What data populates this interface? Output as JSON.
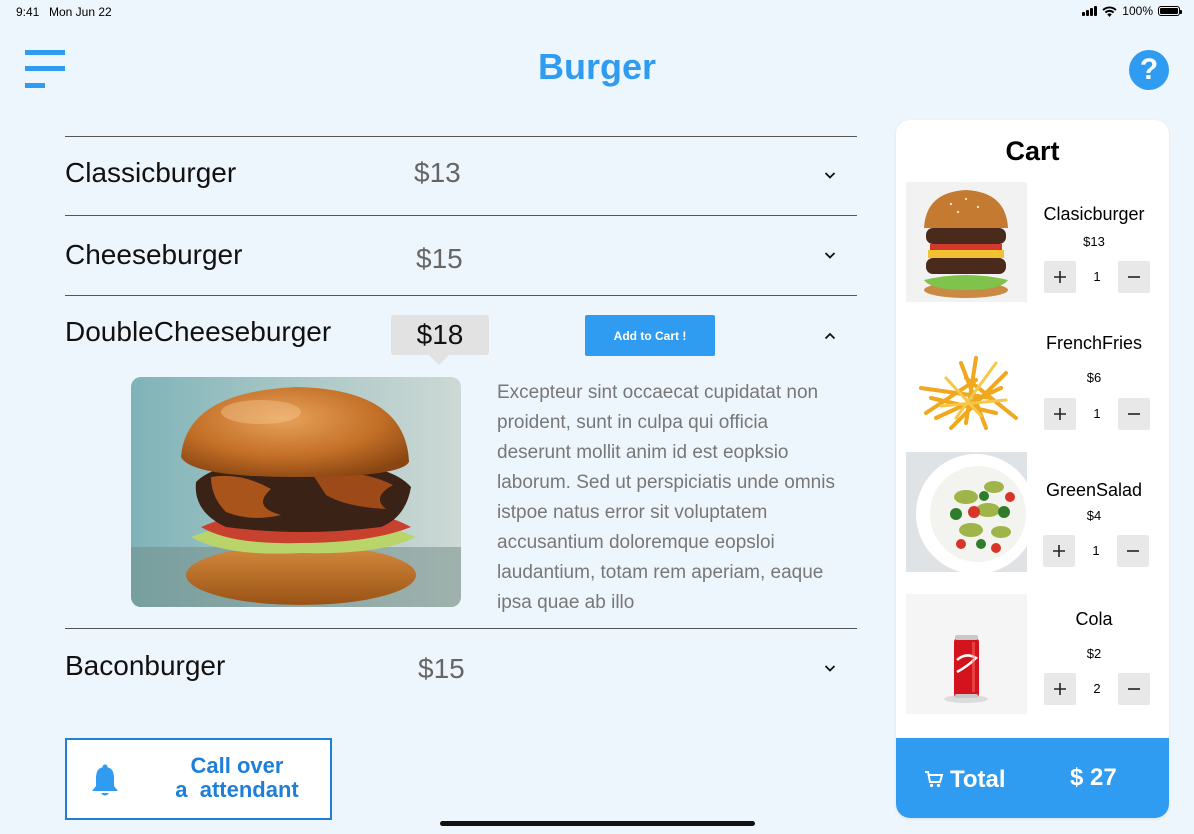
{
  "status_bar": {
    "time": "9:41",
    "date": "Mon Jun 22",
    "battery": "100%"
  },
  "header": {
    "title": "Burger"
  },
  "menu_items": [
    {
      "name": "Classicburger",
      "price": "$13"
    },
    {
      "name": "Cheeseburger",
      "price": "$15"
    },
    {
      "name": "DoubleCheeseburger",
      "price": "$18",
      "expanded": true
    },
    {
      "name": "Baconburger",
      "price": "$15"
    }
  ],
  "expanded_item": {
    "add_button": "Add to Cart !",
    "description": "Excepteur sint occaecat cupidatat non proident, sunt in culpa qui officia deserunt mollit anim id est eopksio laborum. Sed ut perspiciatis unde omnis istpoe natus error sit voluptatem accusantium doloremque eopsloi laudantium, totam rem aperiam, eaque ipsa quae ab illo"
  },
  "call_attendant": {
    "line1": "Call over",
    "line2": "a  attendant"
  },
  "cart": {
    "title": "Cart",
    "items": [
      {
        "name": "Clasicburger",
        "price": "$13",
        "qty": "1"
      },
      {
        "name": "FrenchFries",
        "price": "$6",
        "qty": "1"
      },
      {
        "name": "GreenSalad",
        "price": "$4",
        "qty": "1"
      },
      {
        "name": "Cola",
        "price": "$2",
        "qty": "2"
      }
    ],
    "total_label": "Total",
    "total_value": "$ 27"
  },
  "colors": {
    "accent": "#2f9bf1",
    "attendant": "#1f7fd6",
    "background": "#eef6fd"
  },
  "icons": [
    "hamburger-menu-icon",
    "help-icon",
    "chevron-down-icon",
    "chevron-up-icon",
    "bell-icon",
    "plus-icon",
    "minus-icon",
    "cart-icon"
  ]
}
